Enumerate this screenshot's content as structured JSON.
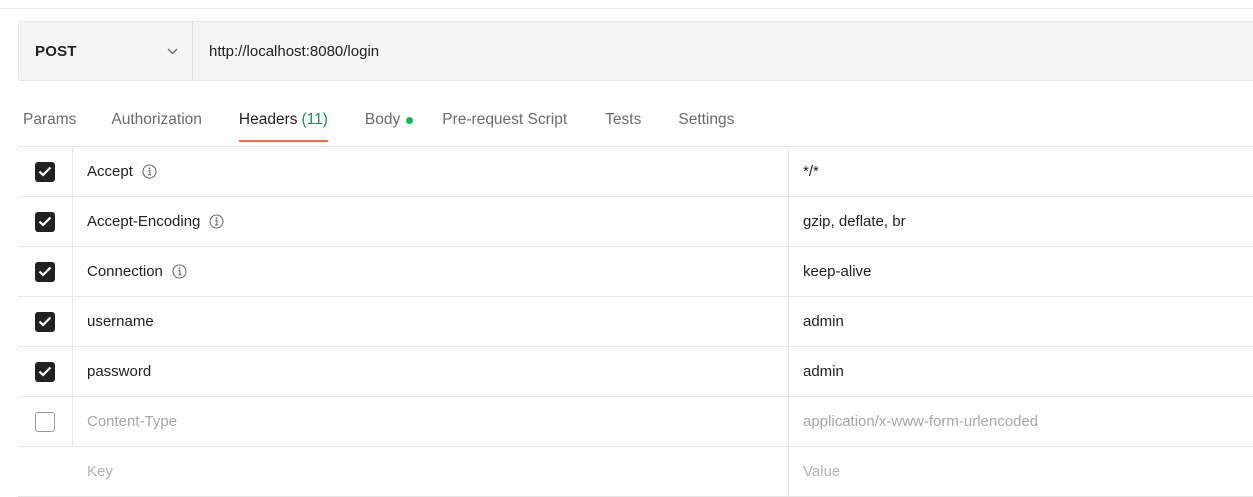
{
  "request": {
    "method": "POST",
    "url": "http://localhost:8080/login"
  },
  "tabs": [
    {
      "label": "Params"
    },
    {
      "label": "Authorization"
    },
    {
      "label": "Headers",
      "count": "(11)",
      "active": true
    },
    {
      "label": "Body",
      "has_dot": true
    },
    {
      "label": "Pre-request Script"
    },
    {
      "label": "Tests"
    },
    {
      "label": "Settings"
    }
  ],
  "headers": [
    {
      "checked": true,
      "key": "Accept",
      "info": true,
      "value": "*/*"
    },
    {
      "checked": true,
      "key": "Accept-Encoding",
      "info": true,
      "value": "gzip, deflate, br"
    },
    {
      "checked": true,
      "key": "Connection",
      "info": true,
      "value": "keep-alive"
    },
    {
      "checked": true,
      "key": "username",
      "info": false,
      "value": "admin"
    },
    {
      "checked": true,
      "key": "password",
      "info": false,
      "value": "admin"
    },
    {
      "checked": false,
      "key": "Content-Type",
      "info": false,
      "value": "application/x-www-form-urlencoded"
    }
  ],
  "new_row": {
    "key_placeholder": "Key",
    "value_placeholder": "Value"
  },
  "colors": {
    "accent": "#ff6c37",
    "count_green": "#0c9a48",
    "dot_green": "#0cbb52"
  }
}
